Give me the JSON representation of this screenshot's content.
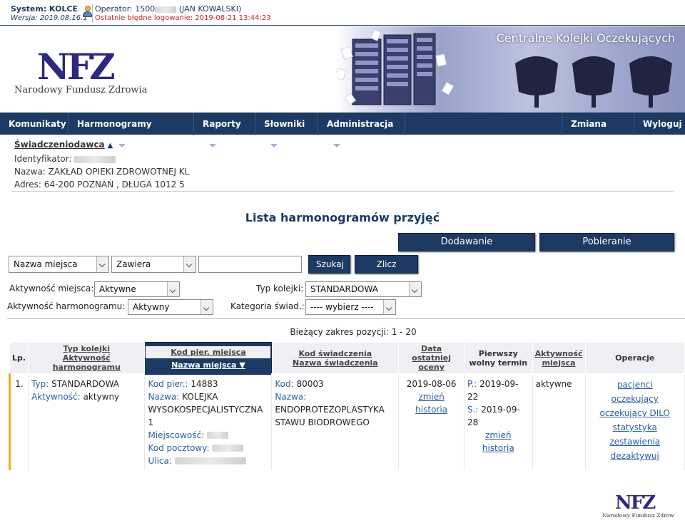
{
  "system": {
    "label": "System: KOLCE",
    "version": "Wersja: 2019.08.16.1"
  },
  "operator": {
    "prefix": "Operator: 1500",
    "suffix": " (JAN KOWALSKI)",
    "last_login": "Ostatnie błędne logowanie: 2019-08-21 13:44:23"
  },
  "banner": {
    "logo": "NFZ",
    "subtitle": "Narodowy Fundusz Zdrowia",
    "title": "Centralne Kolejki Oczekujących"
  },
  "nav": {
    "items": [
      {
        "label": "Komunikaty",
        "dropdown": false
      },
      {
        "label": "Harmonogramy przyjęć",
        "dropdown": true
      },
      {
        "label": "Raporty",
        "dropdown": true
      },
      {
        "label": "Słowniki",
        "dropdown": true
      },
      {
        "label": "Administracja",
        "dropdown": true
      }
    ],
    "right": [
      {
        "label": "Zmiana hasła"
      },
      {
        "label": "Wyloguj"
      }
    ]
  },
  "provider": {
    "header": "Świadczeniodawca",
    "id_label": "Identyfikator:",
    "name_label": "Nazwa:",
    "name_value": "ZAKŁAD OPIEKI ZDROWOTNEJ KL",
    "address_label": "Adres:",
    "address_value": "64-200 POZNAŃ , DŁUGA 1012 5"
  },
  "page_title": "Lista harmonogramów przyjęć",
  "buttons": {
    "add": "Dodawanie harmonogramu",
    "download": "Pobieranie harmonogramu",
    "search": "Szukaj",
    "count": "Zlicz rekordy"
  },
  "filters": {
    "field": "Nazwa miejsca",
    "operator": "Zawiera",
    "text_value": "",
    "place_activity_label": "Aktywność miejsca:",
    "place_activity_value": "Aktywne",
    "schedule_activity_label": "Aktywność harmonogramu:",
    "schedule_activity_value": "Aktywny",
    "queue_type_label": "Typ kolejki:",
    "queue_type_value": "STANDARDOWA",
    "category_label": "Kategoria świad.:",
    "category_value": "---- wybierz ----"
  },
  "range_text": "Bieżący zakres pozycji: 1 - 20",
  "table": {
    "headers": {
      "lp": "Lp.",
      "type_top": "Typ kolejki",
      "type_bottom": "Aktywność harmonogramu",
      "code_top": "Kod pier. miejsca",
      "code_bottom": "Nazwa miejsca",
      "service_top": "Kod świadczenia",
      "service_bottom": "Nazwa świadczenia",
      "last_eval": "Data ostatniej oceny",
      "first_free": "Pierwszy wolny termin",
      "place_activity": "Aktywność miejsca",
      "ops": "Operacje"
    },
    "rows": [
      {
        "lp": "1.",
        "type_label": "Typ:",
        "type_value": "STANDARDOWA",
        "activity_label": "Aktywność:",
        "activity_value": "aktywny",
        "code_label": "Kod pier.:",
        "code_value": "14883",
        "name_label": "Nazwa:",
        "name_value": "KOLEJKA WYSOKOSPECJALISTYCZNA 1",
        "city_label": "Miejscowość:",
        "postal_label": "Kod pocztowy:",
        "street_label": "Ulica:",
        "service_code_label": "Kod:",
        "service_code_value": "80003",
        "service_name_label": "Nazwa:",
        "service_name_value": "ENDOPROTEZOPLASTYKA STAWU BIODROWEGO",
        "eval_date": "2019-08-06",
        "eval_change": "zmień",
        "eval_history": "historia",
        "p_label": "P.:",
        "p_date": "2019-09-22",
        "s_label": "S.:",
        "s_date": "2019-09-28",
        "term_change": "zmień",
        "term_history": "historia",
        "place_activity": "aktywne",
        "ops": [
          "pacjenci",
          "oczekujący",
          "oczekujący DILO",
          "statystyka",
          "zestawienia",
          "dezaktywuj"
        ]
      }
    ]
  },
  "footer_logo": {
    "logo": "NFZ",
    "subtitle": "Narodowy Fundusz Zdrowia"
  }
}
